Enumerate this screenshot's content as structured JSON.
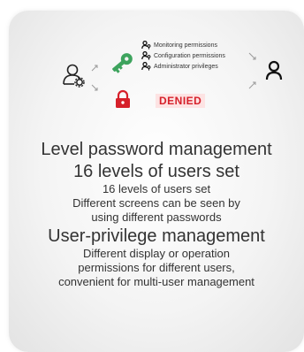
{
  "permissions": [
    "Monitoring permissions",
    "Configuration permissions",
    "Administrator privileges"
  ],
  "denied_label": "DENIED",
  "colors": {
    "key": "#3da35d",
    "lock": "#d6202a",
    "arrow": "#9a9a9a"
  },
  "icons": [
    "user-gear-icon",
    "key-icon",
    "lock-icon",
    "user-icon",
    "user-key-icon"
  ],
  "section1": {
    "title": "Level password management",
    "subtitle": "16 levels of users set",
    "line1": "16 levels of users set",
    "line2": "Different screens can be seen by",
    "line3": "using different passwords"
  },
  "section2": {
    "title": "User-privilege management",
    "line1": "Different display or operation",
    "line2": "permissions for different users,",
    "line3": "convenient for multi-user management"
  }
}
